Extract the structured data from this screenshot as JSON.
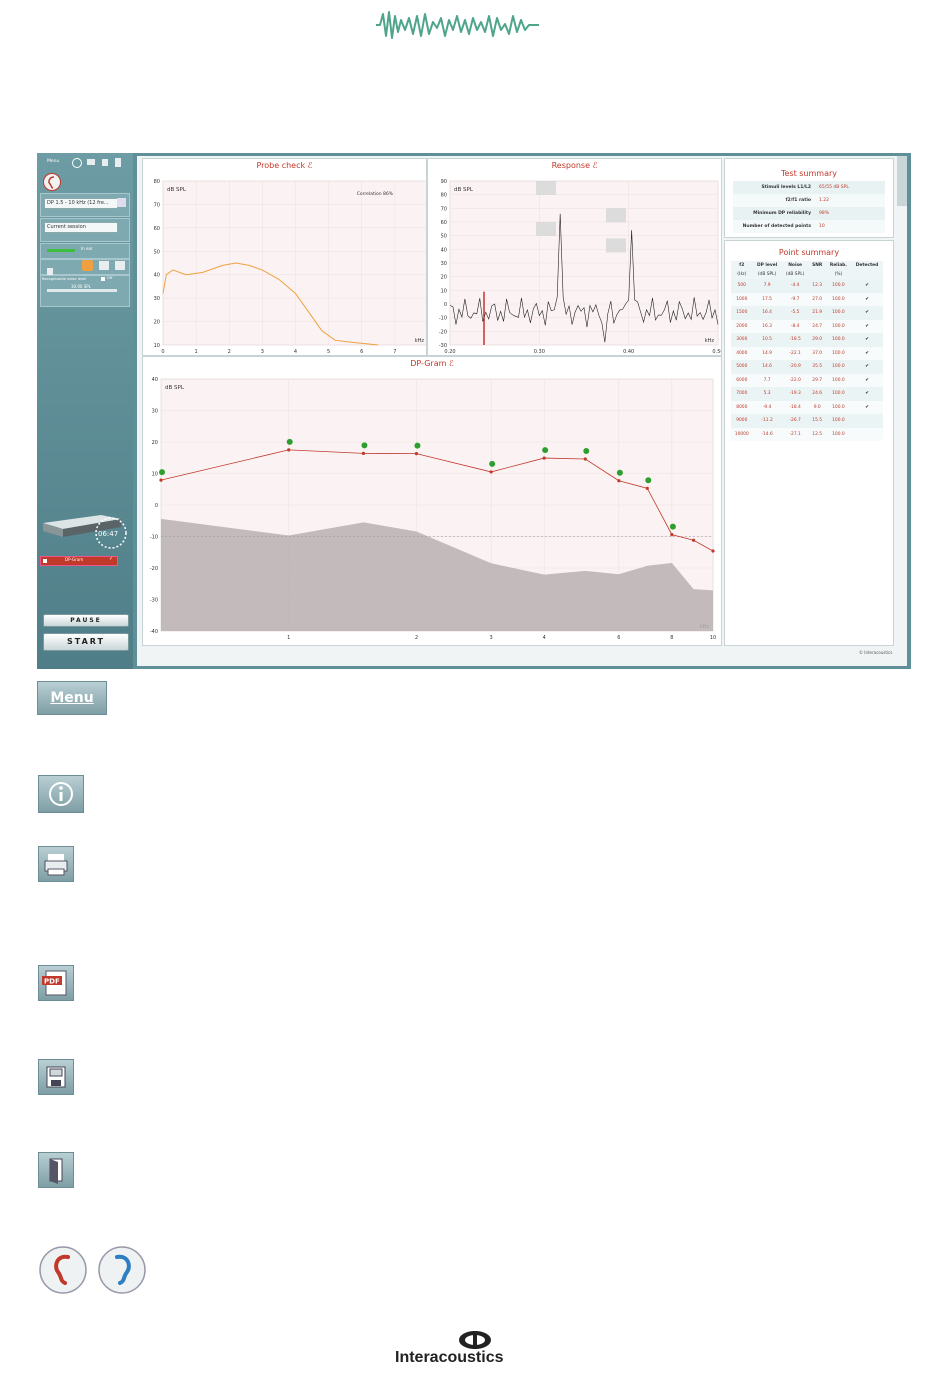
{
  "sidebar": {
    "menu_label": "Menu",
    "protocol_select": "DP 1.5 - 10 kHz (12 fre...",
    "session_select": "Current session",
    "in_ear_label": "In ear",
    "noise_label": "Recognizable noise level",
    "off_label": "Off",
    "level_value": "30.00 SPL",
    "timer": "06:47",
    "test_item": "DP-Gram",
    "pause_label": "PAUSE",
    "start_label": "START"
  },
  "probe_check": {
    "title": "Probe check",
    "yunit": "dB SPL",
    "xunit": "kHz",
    "correlation": "Correlation 86%",
    "yticks": [
      "80",
      "70",
      "60",
      "50",
      "40",
      "30",
      "20",
      "10"
    ],
    "xticks": [
      "0",
      "1",
      "2",
      "3",
      "4",
      "5",
      "6",
      "7",
      "8"
    ]
  },
  "response": {
    "title": "Response",
    "yunit": "dB SPL",
    "xunit": "kHz",
    "yticks": [
      "90",
      "80",
      "70",
      "60",
      "50",
      "40",
      "30",
      "20",
      "10",
      "0",
      "-10",
      "-20",
      "-30"
    ],
    "xticks": [
      "0.20",
      "0.30",
      "0.40",
      "0.50"
    ]
  },
  "dpgram": {
    "title": "DP-Gram",
    "yunit": "dB SPL",
    "xunit": "kHz",
    "yticks": [
      "40",
      "30",
      "20",
      "10",
      "0",
      "-10",
      "-20",
      "-30",
      "-40"
    ],
    "xticks": [
      "1",
      "2",
      "3",
      "4",
      "6",
      "8",
      "10"
    ]
  },
  "test_summary": {
    "title": "Test summary",
    "rows": [
      {
        "label": "Stimuli levels L1/L2",
        "value": "65/55 dB SPL"
      },
      {
        "label": "f2/f1 ratio",
        "value": "1.22"
      },
      {
        "label": "Minimum DP reliability",
        "value": "98%"
      },
      {
        "label": "Number of detected points",
        "value": "10"
      }
    ]
  },
  "point_summary": {
    "title": "Point summary",
    "headers": [
      "f2",
      "DP level",
      "Noise",
      "SNR",
      "Reliab.",
      "Detected"
    ],
    "units": [
      "(Hz)",
      "(dB SPL)",
      "(dB SPL)",
      "",
      "(%)",
      ""
    ],
    "rows": [
      [
        "500",
        "7.9",
        "-4.4",
        "12.3",
        "100.0",
        "✔"
      ],
      [
        "1000",
        "17.5",
        "-9.7",
        "27.0",
        "100.0",
        "✔"
      ],
      [
        "1500",
        "16.4",
        "-5.5",
        "21.9",
        "100.0",
        "✔"
      ],
      [
        "2000",
        "16.3",
        "-8.4",
        "24.7",
        "100.0",
        "✔"
      ],
      [
        "3000",
        "10.5",
        "-18.5",
        "29.0",
        "100.0",
        "✔"
      ],
      [
        "4000",
        "14.9",
        "-22.1",
        "37.0",
        "100.0",
        "✔"
      ],
      [
        "5000",
        "14.6",
        "-20.9",
        "35.5",
        "100.0",
        "✔"
      ],
      [
        "6000",
        "7.7",
        "-22.0",
        "29.7",
        "100.0",
        "✔"
      ],
      [
        "7000",
        "5.3",
        "-19.3",
        "24.6",
        "100.0",
        "✔"
      ],
      [
        "8000",
        "-9.4",
        "-18.4",
        "9.0",
        "100.0",
        "✔"
      ],
      [
        "9000",
        "-11.2",
        "-26.7",
        "15.5",
        "100.0",
        ""
      ],
      [
        "10000",
        "-14.6",
        "-27.1",
        "12.5",
        "100.0",
        ""
      ]
    ]
  },
  "footer_brand": "© Interacoustics",
  "brand_name": "Interacoustics",
  "colors": {
    "accent": "#c0392b",
    "probe": "#f0a040",
    "detected": "#2e9e2e",
    "sidebar": "#5f8f98"
  }
}
